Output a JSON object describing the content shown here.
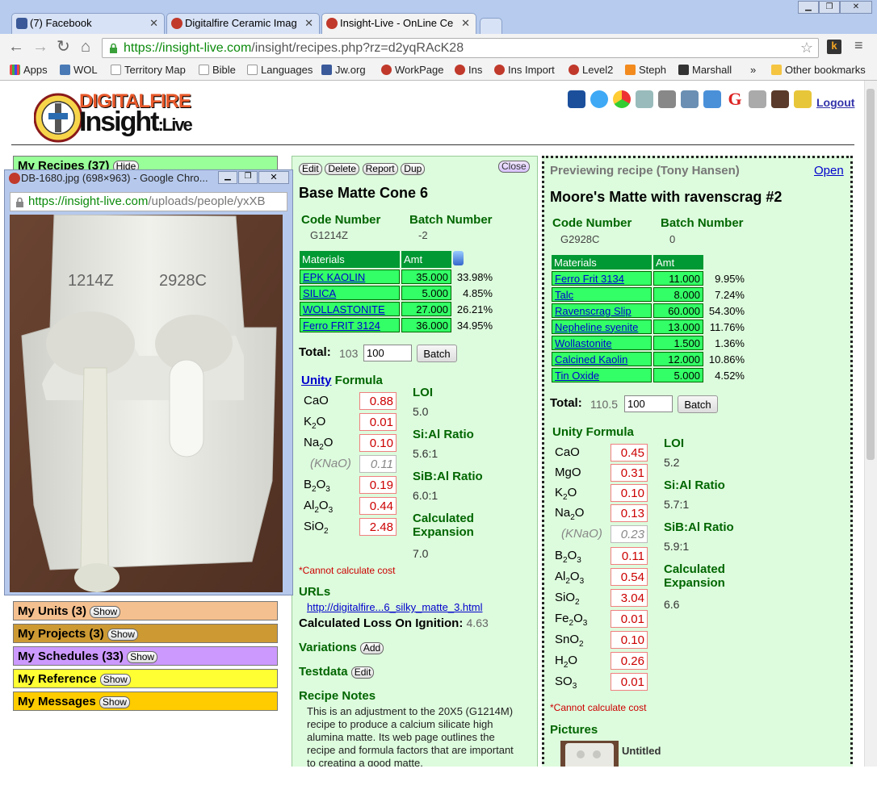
{
  "browser": {
    "tabs": [
      {
        "title": "(7) Facebook",
        "icon": "facebook-icon",
        "active": false
      },
      {
        "title": "Digitalfire Ceramic Imag",
        "icon": "digitalfire-icon",
        "active": false
      },
      {
        "title": "Insight-Live - OnLine Ce",
        "icon": "digitalfire-icon",
        "active": true
      }
    ],
    "url_host": "https://insight-live.com",
    "url_path": "/insight/recipes.php?rz=d2yqRAcK28",
    "bookmarks": [
      "Apps",
      "WOL",
      "Territory Map",
      "Bible",
      "Languages",
      "Jw.org",
      "WorkPage",
      "Ins",
      "Ins Import",
      "Level2",
      "Steph",
      "Marshall"
    ],
    "bookmarks_more": "»",
    "other_bookmarks": "Other bookmarks"
  },
  "header": {
    "logo_top": "DIGITALFIRE",
    "logo_bottom": "Insight",
    "logo_suffix": ":Live",
    "logout": "Logout"
  },
  "sidebar": {
    "sections": [
      {
        "label": "My Recipes (37)",
        "button": "Hide",
        "color": "#99ff99"
      },
      {
        "label": "My Units (3)",
        "button": "Show",
        "color": "#f5c08f"
      },
      {
        "label": "My Projects (3)",
        "button": "Show",
        "color": "#cc9933"
      },
      {
        "label": "My Schedules (33)",
        "button": "Show",
        "color": "#cc99ff"
      },
      {
        "label": "My Reference",
        "button": "Show",
        "color": "#ffff33"
      },
      {
        "label": "My Messages",
        "button": "Show",
        "color": "#ffcc00"
      }
    ]
  },
  "popup": {
    "title": "DB-1680.jpg (698×963) - Google Chro...",
    "url_host": "https://insight-live.com",
    "url_path": "/uploads/people/yxXB",
    "label_left": "1214Z",
    "label_right": "2928C"
  },
  "recipe": {
    "buttons": [
      "Edit",
      "Delete",
      "Report",
      "Dup"
    ],
    "close": "Close",
    "title": "Base Matte Cone 6",
    "code_label": "Code Number",
    "code": "G1214Z",
    "batch_label": "Batch Number",
    "batch": "-2",
    "mat_header": "Materials",
    "amt_header": "Amt",
    "materials": [
      {
        "name": "EPK KAOLIN",
        "amt": "35.000",
        "pct": "33.98%"
      },
      {
        "name": "SILICA",
        "amt": "5.000",
        "pct": "4.85%"
      },
      {
        "name": "WOLLASTONITE",
        "amt": "27.000",
        "pct": "26.21%"
      },
      {
        "name": "Ferro FRIT 3124",
        "amt": "36.000",
        "pct": "34.95%"
      }
    ],
    "total_label": "Total:",
    "total": "103",
    "batch_input": "100",
    "batch_button": "Batch",
    "unity_link": "Unity",
    "formula_label": "Formula",
    "oxides": [
      {
        "f": "CaO",
        "v": "0.88"
      },
      {
        "f": "K2O",
        "v": "0.01"
      },
      {
        "f": "Na2O",
        "v": "0.10"
      },
      {
        "f": "(KNaO)",
        "v": "0.11"
      },
      {
        "f": "B2O3",
        "v": "0.19"
      },
      {
        "f": "Al2O3",
        "v": "0.44"
      },
      {
        "f": "SiO2",
        "v": "2.48"
      }
    ],
    "loi_label": "LOI",
    "loi": "5.0",
    "si_al_label": "Si:Al Ratio",
    "si_al": "5.6:1",
    "sib_al_label": "SiB:Al Ratio",
    "sib_al": "6.0:1",
    "exp_label1": "Calculated",
    "exp_label2": "Expansion",
    "exp": "7.0",
    "no_cost": "*Cannot calculate cost",
    "urls_label": "URLs",
    "url": "http://digitalfire...6_silky_matte_3.html",
    "calc_loi_label": "Calculated Loss On Ignition:",
    "calc_loi": "4.63",
    "variations_label": "Variations",
    "add_btn": "Add",
    "testdata_label": "Testdata",
    "edit_btn": "Edit",
    "notes_label": "Recipe Notes",
    "notes": "This is an adjustment to the 20X5 (G1214M) recipe to produce a calcium silicate high alumina matte. Its web page outlines the recipe and formula factors that are important to creating a good matte."
  },
  "preview": {
    "caption": "Previewing recipe (Tony Hansen)",
    "open": "Open",
    "title": "Moore's Matte with ravenscrag #2",
    "code_label": "Code Number",
    "code": "G2928C",
    "batch_label": "Batch Number",
    "batch": "0",
    "mat_header": "Materials",
    "amt_header": "Amt",
    "materials": [
      {
        "name": "Ferro Frit 3134",
        "amt": "11.000",
        "pct": "9.95%"
      },
      {
        "name": "Talc",
        "amt": "8.000",
        "pct": "7.24%"
      },
      {
        "name": "Ravenscrag Slip",
        "amt": "60.000",
        "pct": "54.30%"
      },
      {
        "name": "Nepheline syenite",
        "amt": "13.000",
        "pct": "11.76%"
      },
      {
        "name": "Wollastonite",
        "amt": "1.500",
        "pct": "1.36%"
      },
      {
        "name": "Calcined Kaolin",
        "amt": "12.000",
        "pct": "10.86%"
      },
      {
        "name": "Tin Oxide",
        "amt": "5.000",
        "pct": "4.52%"
      }
    ],
    "total_label": "Total:",
    "total": "110.5",
    "batch_input": "100",
    "batch_button": "Batch",
    "formula_label": "Unity Formula",
    "oxides": [
      {
        "f": "CaO",
        "v": "0.45"
      },
      {
        "f": "MgO",
        "v": "0.31"
      },
      {
        "f": "K2O",
        "v": "0.10"
      },
      {
        "f": "Na2O",
        "v": "0.13"
      },
      {
        "f": "(KNaO)",
        "v": "0.23"
      },
      {
        "f": "B2O3",
        "v": "0.11"
      },
      {
        "f": "Al2O3",
        "v": "0.54"
      },
      {
        "f": "SiO2",
        "v": "3.04"
      },
      {
        "f": "Fe2O3",
        "v": "0.01"
      },
      {
        "f": "SnO2",
        "v": "0.10"
      },
      {
        "f": "H2O",
        "v": "0.26"
      },
      {
        "f": "SO3",
        "v": "0.01"
      }
    ],
    "loi_label": "LOI",
    "loi": "5.2",
    "si_al_label": "Si:Al Ratio",
    "si_al": "5.7:1",
    "sib_al_label": "SiB:Al Ratio",
    "sib_al": "5.9:1",
    "exp_label1": "Calculated",
    "exp_label2": "Expansion",
    "exp": "6.6",
    "no_cost": "*Cannot calculate cost",
    "pictures_label": "Pictures",
    "picture_caption": "Untitled"
  }
}
